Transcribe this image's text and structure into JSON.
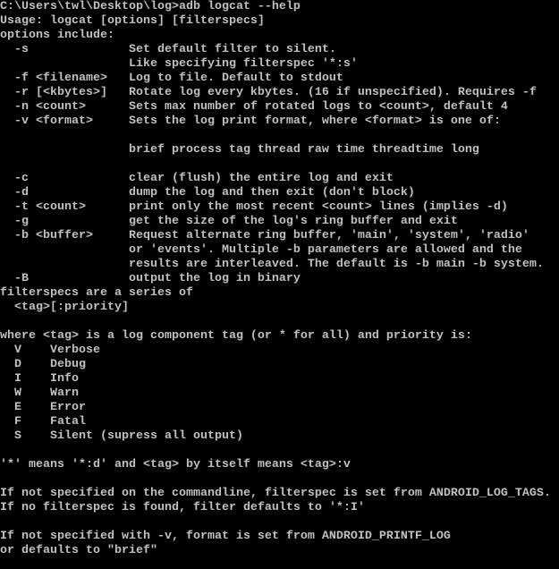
{
  "window": {
    "background": "#000000",
    "foreground": "#c0c0c0"
  },
  "console": {
    "lines": [
      "C:\\Users\\twl\\Desktop\\log>adb logcat --help",
      "Usage: logcat [options] [filterspecs]",
      "options include:",
      "  -s              Set default filter to silent.",
      "                  Like specifying filterspec '*:s'",
      "  -f <filename>   Log to file. Default to stdout",
      "  -r [<kbytes>]   Rotate log every kbytes. (16 if unspecified). Requires -f",
      "  -n <count>      Sets max number of rotated logs to <count>, default 4",
      "  -v <format>     Sets the log print format, where <format> is one of:",
      "",
      "                  brief process tag thread raw time threadtime long",
      "",
      "  -c              clear (flush) the entire log and exit",
      "  -d              dump the log and then exit (don't block)",
      "  -t <count>      print only the most recent <count> lines (implies -d)",
      "  -g              get the size of the log's ring buffer and exit",
      "  -b <buffer>     Request alternate ring buffer, 'main', 'system', 'radio'",
      "                  or 'events'. Multiple -b parameters are allowed and the",
      "                  results are interleaved. The default is -b main -b system.",
      "  -B              output the log in binary",
      "filterspecs are a series of",
      "  <tag>[:priority]",
      "",
      "where <tag> is a log component tag (or * for all) and priority is:",
      "  V    Verbose",
      "  D    Debug",
      "  I    Info",
      "  W    Warn",
      "  E    Error",
      "  F    Fatal",
      "  S    Silent (supress all output)",
      "",
      "'*' means '*:d' and <tag> by itself means <tag>:v",
      "",
      "If not specified on the commandline, filterspec is set from ANDROID_LOG_TAGS.",
      "If no filterspec is found, filter defaults to '*:I'",
      "",
      "If not specified with -v, format is set from ANDROID_PRINTF_LOG",
      "or defaults to \"brief\""
    ]
  }
}
